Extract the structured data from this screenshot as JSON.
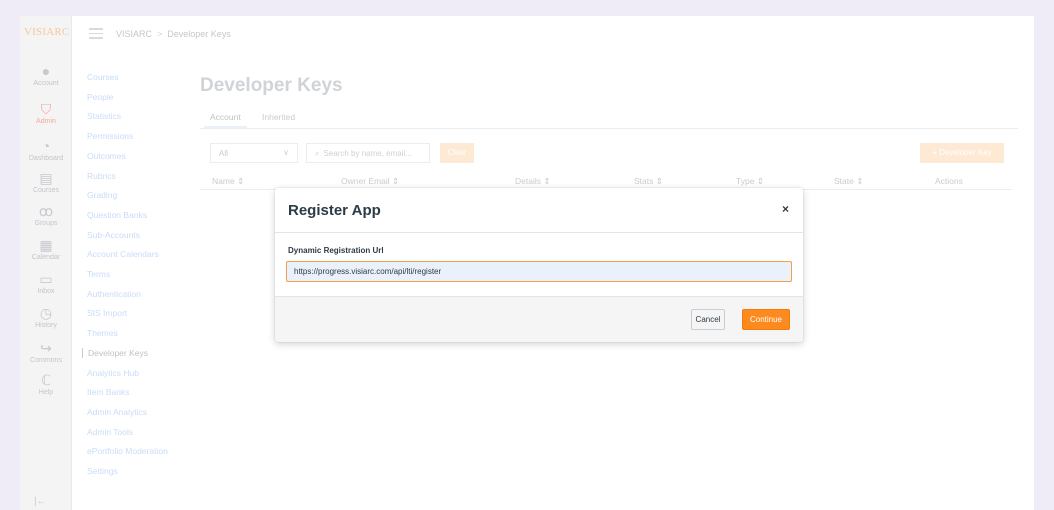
{
  "brand": {
    "logo_text": "VISIARC"
  },
  "global_nav": {
    "items": [
      {
        "label": "Account",
        "icon": "avatar-icon"
      },
      {
        "label": "Admin",
        "icon": "shield-icon",
        "active": true
      },
      {
        "label": "Dashboard",
        "icon": "dashboard-icon"
      },
      {
        "label": "Courses",
        "icon": "book-icon"
      },
      {
        "label": "Groups",
        "icon": "groups-icon"
      },
      {
        "label": "Calendar",
        "icon": "calendar-icon"
      },
      {
        "label": "Inbox",
        "icon": "inbox-icon"
      },
      {
        "label": "History",
        "icon": "clock-icon"
      },
      {
        "label": "Commons",
        "icon": "commons-icon"
      },
      {
        "label": "Help",
        "icon": "help-icon"
      }
    ]
  },
  "breadcrumb": {
    "root": "VISIARC",
    "separator": ">",
    "current": "Developer Keys"
  },
  "course_nav": {
    "items": [
      "Courses",
      "People",
      "Statistics",
      "Permissions",
      "Outcomes",
      "Rubrics",
      "Grading",
      "Question Banks",
      "Sub-Accounts",
      "Account Calendars",
      "Terms",
      "Authentication",
      "SIS Import",
      "Themes",
      "Developer Keys",
      "Analytics Hub",
      "Item Banks",
      "Admin Analytics",
      "Admin Tools",
      "ePortfolio Moderation",
      "Settings"
    ],
    "active": "Developer Keys"
  },
  "page": {
    "title": "Developer Keys",
    "tabs": [
      {
        "label": "Account",
        "active": true
      },
      {
        "label": "Inherited"
      }
    ],
    "filter": {
      "selected": "All"
    },
    "search": {
      "placeholder": "Search by name, email..."
    },
    "clear_label": "Clear",
    "add_key_label": "+ Developer Key",
    "columns": [
      "Name",
      "Owner Email",
      "Details",
      "Stats",
      "Type",
      "State",
      "Actions"
    ],
    "sort_glyph": "⇕"
  },
  "modal": {
    "title": "Register App",
    "close_glyph": "×",
    "field_label": "Dynamic Registration Url",
    "url_value": "https://progress.visiarc.com/api/lti/register",
    "cancel_label": "Cancel",
    "continue_label": "Continue"
  },
  "colors": {
    "accent_orange": "#fc8a1f",
    "text_dark": "#2d3b45",
    "link_blue": "#2b7abc"
  }
}
